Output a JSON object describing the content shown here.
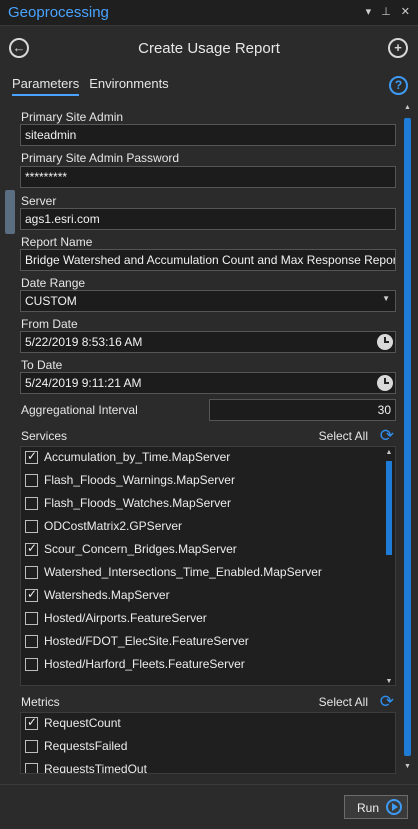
{
  "pane": {
    "title": "Geoprocessing",
    "title_icons": [
      "pin-icon",
      "auto-hide-icon",
      "close-icon"
    ]
  },
  "tool": {
    "title": "Create Usage Report"
  },
  "tabs": [
    {
      "label": "Parameters",
      "active": true
    },
    {
      "label": "Environments",
      "active": false
    }
  ],
  "params": {
    "primary_site_admin": {
      "label": "Primary Site Admin",
      "value": "siteadmin"
    },
    "primary_site_admin_password": {
      "label": "Primary Site Admin Password",
      "value": "*********"
    },
    "server": {
      "label": "Server",
      "value": "ags1.esri.com"
    },
    "report_name": {
      "label": "Report Name",
      "value": "Bridge Watershed and Accumulation Count and Max Response Report"
    },
    "date_range": {
      "label": "Date Range",
      "value": "CUSTOM"
    },
    "from_date": {
      "label": "From Date",
      "value": "5/22/2019 8:53:16 AM"
    },
    "to_date": {
      "label": "To Date",
      "value": "5/24/2019 9:11:21 AM"
    },
    "aggregational_interval": {
      "label": "Aggregational Interval",
      "value": "30"
    }
  },
  "services": {
    "label": "Services",
    "select_all": "Select All",
    "items": [
      {
        "label": "Accumulation_by_Time.MapServer",
        "checked": true
      },
      {
        "label": "Flash_Floods_Warnings.MapServer",
        "checked": false
      },
      {
        "label": "Flash_Floods_Watches.MapServer",
        "checked": false
      },
      {
        "label": "ODCostMatrix2.GPServer",
        "checked": false
      },
      {
        "label": "Scour_Concern_Bridges.MapServer",
        "checked": true
      },
      {
        "label": "Watershed_Intersections_Time_Enabled.MapServer",
        "checked": false
      },
      {
        "label": "Watersheds.MapServer",
        "checked": true
      },
      {
        "label": "Hosted/Airports.FeatureServer",
        "checked": false
      },
      {
        "label": "Hosted/FDOT_ElecSite.FeatureServer",
        "checked": false
      },
      {
        "label": "Hosted/Harford_Fleets.FeatureServer",
        "checked": false
      }
    ]
  },
  "metrics": {
    "label": "Metrics",
    "select_all": "Select All",
    "items": [
      {
        "label": "RequestCount",
        "checked": true
      },
      {
        "label": "RequestsFailed",
        "checked": false
      },
      {
        "label": "RequestsTimedOut",
        "checked": false
      }
    ]
  },
  "footer": {
    "run_label": "Run"
  },
  "colors": {
    "accent": "#4aa3ff",
    "scroll_thumb": "#1f7cd6",
    "background": "#2b2b2b",
    "input_bg": "#1c1c1c"
  }
}
